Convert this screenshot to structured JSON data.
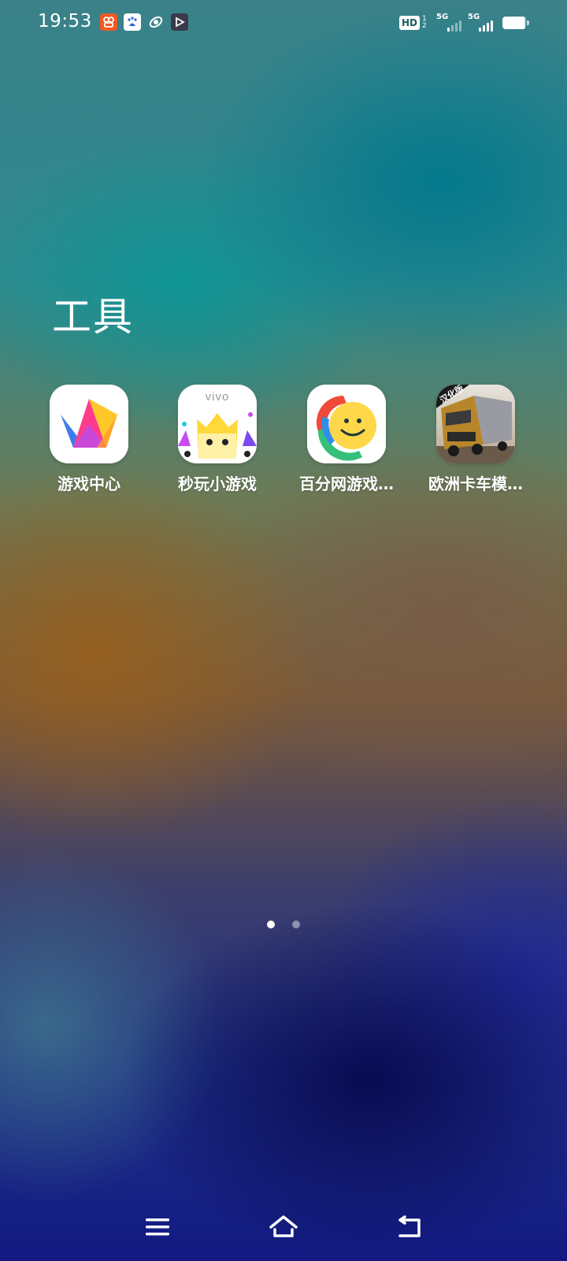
{
  "status_bar": {
    "time": "19:53",
    "notification_icons": [
      "kuaishou-icon",
      "baidu-icon",
      "browser-icon",
      "video-player-icon"
    ],
    "hd_label": "HD",
    "hd_sub_top": "1",
    "hd_sub_bottom": "2",
    "sim1_label": "5G",
    "sim2_label": "5G",
    "battery_level": 0.95
  },
  "folder": {
    "title": "工具"
  },
  "apps": [
    {
      "label": "游戏中心",
      "icon": "game-center-icon"
    },
    {
      "label": "秒玩小游戏",
      "icon": "vivo-mini-games-icon"
    },
    {
      "label": "百分网游戏…",
      "icon": "baifen-games-icon"
    },
    {
      "label": "欧洲卡车模…",
      "icon": "euro-truck-sim-icon"
    }
  ],
  "app_icon_texts": {
    "vivo_brand": "vivo",
    "truck_badge": "汉化版"
  },
  "page_indicator": {
    "total": 2,
    "current": 1
  },
  "nav_bar": {
    "buttons": [
      "menu-icon",
      "home-icon",
      "back-icon"
    ]
  },
  "colors": {
    "text": "#ffffff",
    "game_center_pink": "#ff3c8c",
    "game_center_yellow": "#ffc82a",
    "game_center_blue": "#3c7cf0",
    "smile_yellow": "#ffd84a",
    "smile_red": "#f04a3a",
    "smile_green": "#34c07a",
    "smile_blue": "#2f8fe8"
  }
}
